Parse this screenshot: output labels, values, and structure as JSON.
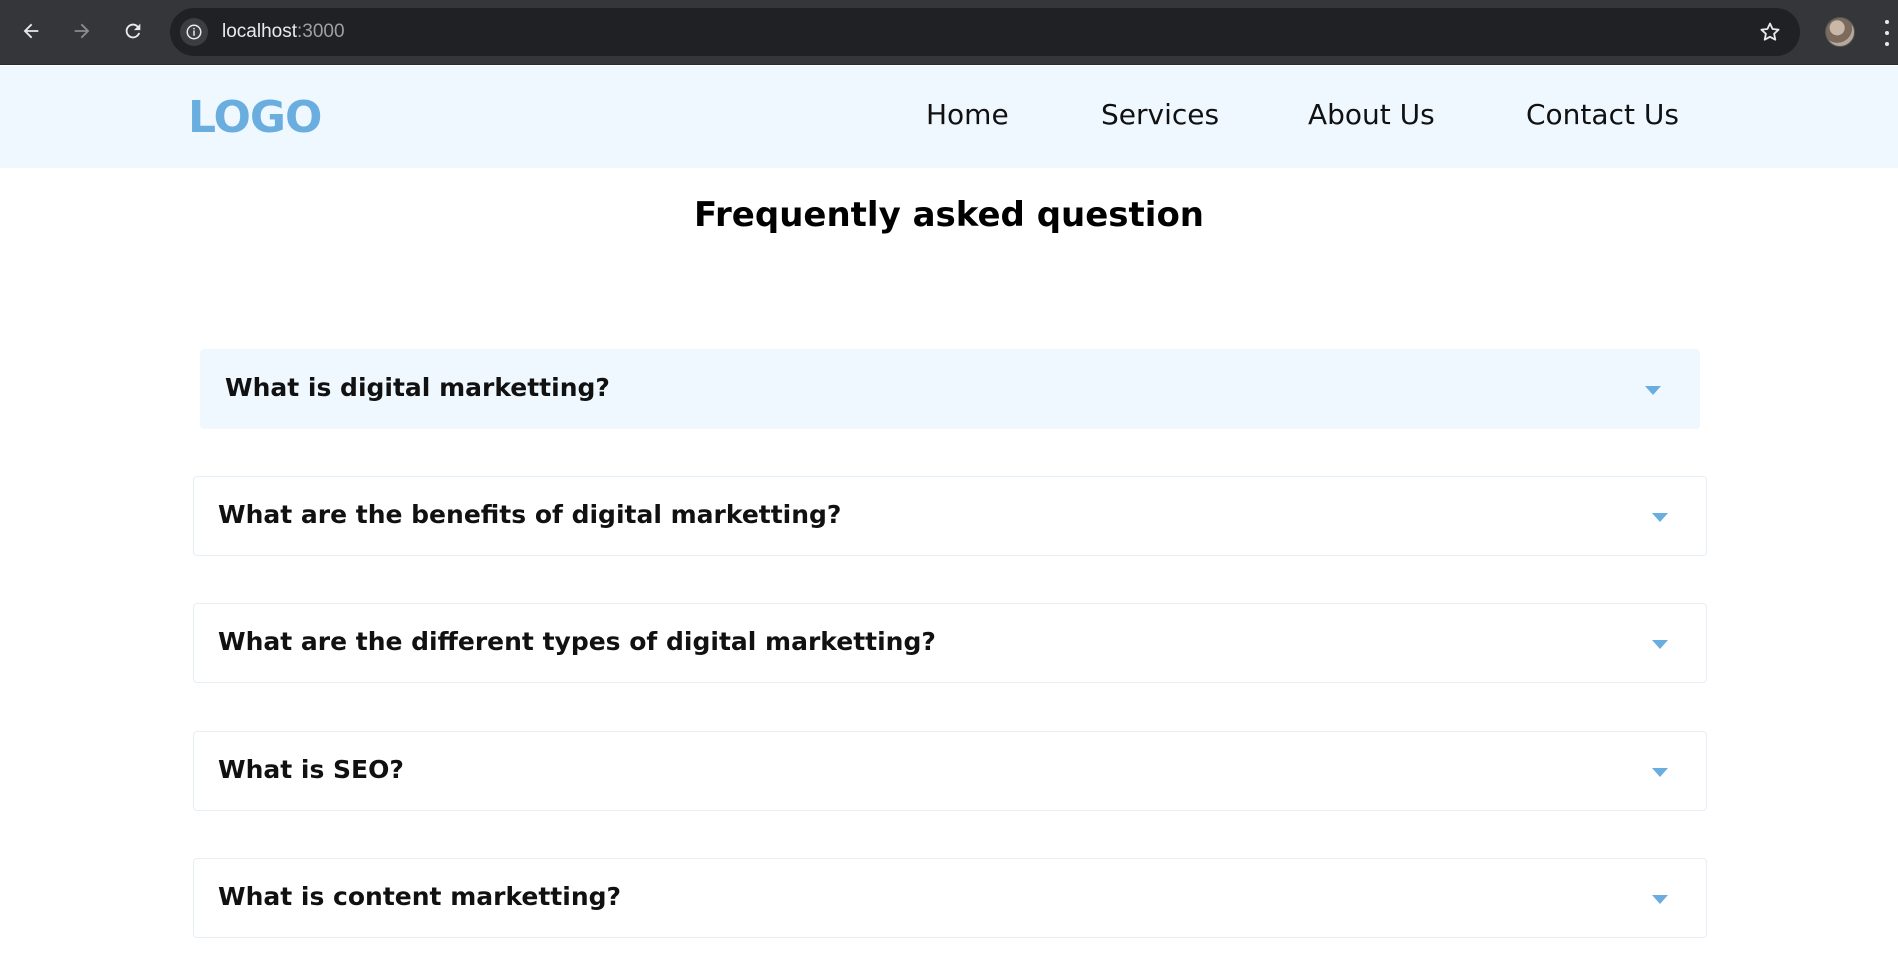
{
  "browser": {
    "url_host": "localhost",
    "url_port": ":3000",
    "icons": {
      "back": "back-arrow-icon",
      "forward": "forward-arrow-icon",
      "reload": "reload-icon",
      "site_info": "info-icon",
      "bookmark": "star-icon",
      "menu": "more-vert-icon"
    }
  },
  "header": {
    "logo": "LOGO",
    "nav": [
      {
        "label": "Home"
      },
      {
        "label": "Services"
      },
      {
        "label": "About Us"
      },
      {
        "label": "Contact Us"
      }
    ]
  },
  "faq": {
    "title": "Frequently asked question",
    "items": [
      {
        "question": "What is digital marketting?",
        "active": true
      },
      {
        "question": "What are the benefits of digital marketting?",
        "active": false
      },
      {
        "question": "What are the different types of digital marketting?",
        "active": false
      },
      {
        "question": "What is SEO?",
        "active": false
      },
      {
        "question": "What is content marketting?",
        "active": false
      }
    ]
  },
  "colors": {
    "accent": "#6aaee0",
    "header_bg": "#f0f8ff",
    "chrome_bg": "#35363a",
    "omnibox_bg": "#202124"
  }
}
